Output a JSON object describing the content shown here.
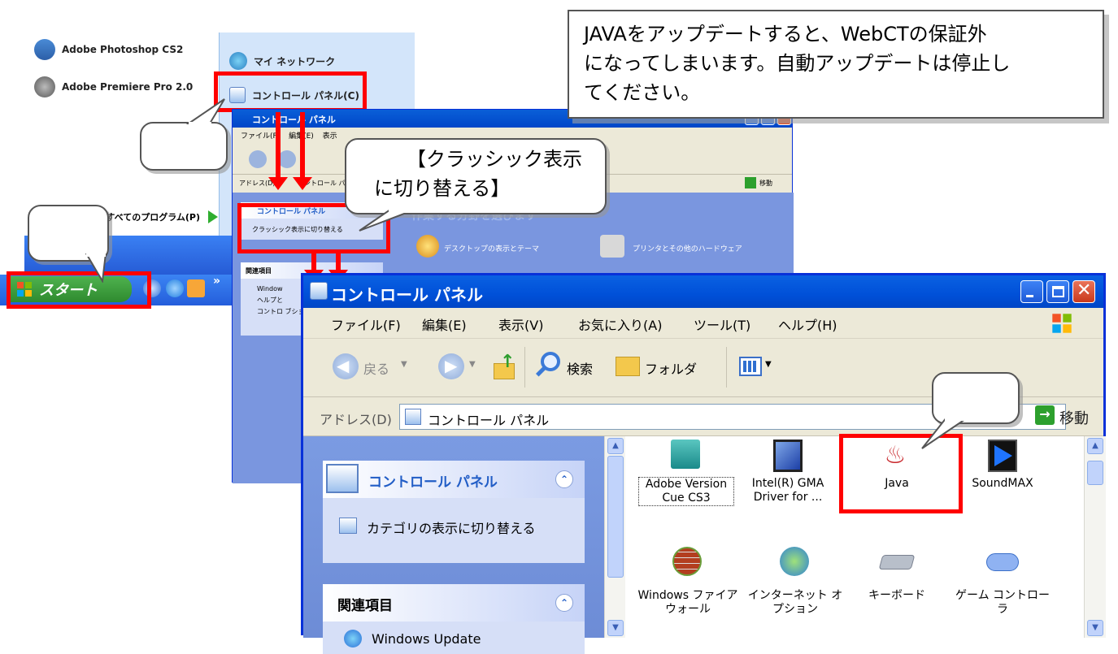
{
  "note": {
    "line1": "JAVAをアップデートすると、WebCTの保証外",
    "line2": "になってしまいます。自動アップデートは停止し",
    "line3": "てください。"
  },
  "callout_classic": {
    "line1": "【クラッシック表示",
    "line2": "に切り替える】"
  },
  "start_menu": {
    "items_left": [
      "Adobe Photoshop CS2",
      "Adobe Premiere Pro 2.0"
    ],
    "items_right": [
      "マイ ネットワーク",
      "コントロール パネル(C)"
    ],
    "all_programs": "すべてのプログラム(P)",
    "start_label": "スタート"
  },
  "small_window": {
    "title": "コントロール パネル",
    "menu": [
      "ファイル(F)",
      "編集(E)",
      "表示"
    ],
    "address_label": "アドレス(D)",
    "address_value": "コントロール パ",
    "go_label": "移動",
    "panel_title": "コントロール パネル",
    "switch_classic": "クラッシック表示に切り替える",
    "related_title": "関連項目",
    "related_items": [
      "Window",
      "ヘルプと",
      "コントロ ブション"
    ],
    "category_heading": "作業する分野を選びます",
    "categories": [
      "デスクトップの表示とテーマ",
      "プリンタとその他のハードウェア"
    ]
  },
  "main_window": {
    "title": "コントロール パネル",
    "menu": [
      "ファイル(F)",
      "編集(E)",
      "表示(V)",
      "お気に入り(A)",
      "ツール(T)",
      "ヘルプ(H)"
    ],
    "toolbar": {
      "back": "戻る",
      "search": "検索",
      "folders": "フォルダ"
    },
    "address_label": "アドレス(D)",
    "address_value": "コントロール パネル",
    "go_label": "移動",
    "side_panel_title": "コントロール パネル",
    "switch_category": "カテゴリの表示に切り替える",
    "related_title": "関連項目",
    "related_items": [
      "Windows Update"
    ],
    "icons": [
      {
        "label": "Adobe Version Cue CS3"
      },
      {
        "label": "Intel(R) GMA Driver for ..."
      },
      {
        "label": "Java"
      },
      {
        "label": "SoundMAX"
      },
      {
        "label": "Windows ファイアウォール"
      },
      {
        "label": "インターネット オプション"
      },
      {
        "label": "キーボード"
      },
      {
        "label": "ゲーム コントローラ"
      }
    ]
  },
  "colors": {
    "annotation_red": "#ff0000",
    "xp_blue": "#0050d8",
    "start_green": "#3b9b3b"
  }
}
